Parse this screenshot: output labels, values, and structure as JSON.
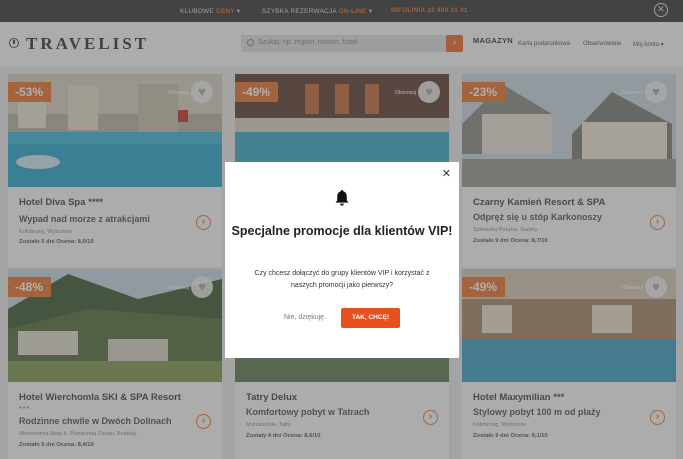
{
  "topbar": {
    "club_label": "KLUBOWE",
    "club_accent": "CENY",
    "reservation_label": "SZYBKA REZERWACJA",
    "reservation_accent": "ON-LINE",
    "hotline_label": "INFOLINIA",
    "hotline_number": "22 460 21 91",
    "close_glyph": "✕"
  },
  "header": {
    "logo": "TRAVELIST",
    "search_placeholder": "Szukaj: np. region, miasto, hotel",
    "magazine": "MAGAZYN",
    "links": [
      "Karta podarunkowa",
      "Obserwowane",
      "Mój konto ▾"
    ]
  },
  "cards": [
    {
      "discount": "-53%",
      "name": "Hotel Diva Spa ****",
      "stars": "",
      "tagline": "Wypad nad morze z atrakcjami",
      "location": "Kołobrzeg, Wybrzeże",
      "meta": "Zostało 5 dni     Ocena: 8,0/10"
    },
    {
      "discount": "-49%",
      "name": "",
      "stars": "",
      "tagline": "",
      "location": "",
      "meta": ""
    },
    {
      "discount": "-23%",
      "name": "Czarny Kamień Resort & SPA",
      "stars": "",
      "tagline": "Odpręż się u stóp Karkonoszy",
      "location": "Szklarska Poręba, Sudety",
      "meta": "Zostało 9 dni     Ocena: 8,7/10"
    },
    {
      "discount": "-48%",
      "name": "Hotel Wierchomla SKI & SPA Resort",
      "stars": "***",
      "tagline": "Rodzinne chwile w Dwóch Dolinach",
      "location": "Wierchomla Mała k. Piwnicznej-Zdroju, Beskidy",
      "meta": "Zostało 5 dni     Ocena: 8,4/10"
    },
    {
      "discount": "",
      "name": "Tatry Delux",
      "stars": "",
      "tagline": "Komfortowy pobyt w Tatrach",
      "location": "Murzasichle, Tatry",
      "meta": "Zostały 4 dni     Ocena: 8,6/10"
    },
    {
      "discount": "-49%",
      "name": "Hotel Maxymilian ***",
      "stars": "",
      "tagline": "Stylowy pobyt 100 m od plaży",
      "location": "Kołobrzeg, Wybrzeże",
      "meta": "Zostało 9 dni     Ocena: 9,1/10"
    }
  ],
  "observe_label": "Obserwuj",
  "modal": {
    "close_glyph": "✕",
    "title": "Specjalne promocje dla klientów VIP!",
    "body": "Czy chcesz dołączyć do grupy klientów VIP i korzystać z naszych promocji jako pierwszy?",
    "decline_label": "Nie, dziękuję.",
    "accept_label": "TAK, CHCĘ!"
  },
  "colors": {
    "accent": "#e8732e",
    "accept_button": "#e8501e",
    "topbar": "#3a3a3a"
  }
}
